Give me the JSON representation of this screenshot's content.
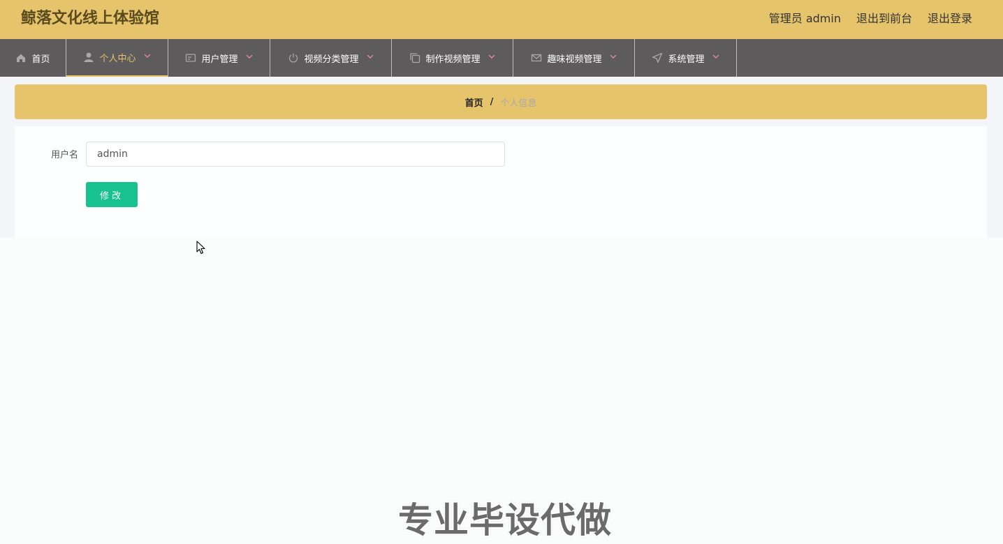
{
  "header": {
    "site_title": "鲸落文化线上体验馆",
    "user_label": "管理员 admin",
    "links": [
      "退出到前台",
      "退出登录"
    ]
  },
  "nav": {
    "items": [
      {
        "label": "首页",
        "icon": "home-icon"
      },
      {
        "label": "个人中心",
        "icon": "user-icon",
        "active": true
      },
      {
        "label": "用户管理",
        "icon": "id-card-icon"
      },
      {
        "label": "视频分类管理",
        "icon": "power-icon"
      },
      {
        "label": "制作视频管理",
        "icon": "copy-icon"
      },
      {
        "label": "趣味视频管理",
        "icon": "mail-icon"
      },
      {
        "label": "系统管理",
        "icon": "send-icon"
      }
    ]
  },
  "breadcrumb": {
    "home": "首页",
    "separator": "/",
    "current": "个人信息"
  },
  "form": {
    "username_label": "用户名",
    "username_value": "admin",
    "submit_label": "修改"
  },
  "watermark": "专业毕设代做",
  "colors": {
    "topbar": "#e6c46c",
    "navbar": "#5d5b5b",
    "accent": "#e6c46c",
    "button": "#18c28e",
    "chevron": "#e08aa0"
  }
}
